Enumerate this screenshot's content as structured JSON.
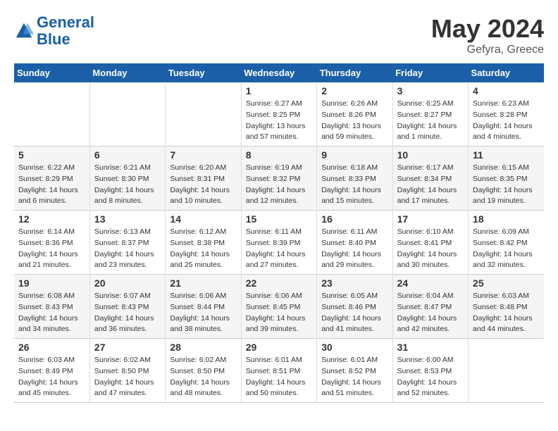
{
  "header": {
    "logo_line1": "General",
    "logo_line2": "Blue",
    "month_year": "May 2024",
    "location": "Gefyra, Greece"
  },
  "days_of_week": [
    "Sunday",
    "Monday",
    "Tuesday",
    "Wednesday",
    "Thursday",
    "Friday",
    "Saturday"
  ],
  "weeks": [
    [
      {
        "day": "",
        "info": ""
      },
      {
        "day": "",
        "info": ""
      },
      {
        "day": "",
        "info": ""
      },
      {
        "day": "1",
        "info": "Sunrise: 6:27 AM\nSunset: 8:25 PM\nDaylight: 13 hours\nand 57 minutes."
      },
      {
        "day": "2",
        "info": "Sunrise: 6:26 AM\nSunset: 8:26 PM\nDaylight: 13 hours\nand 59 minutes."
      },
      {
        "day": "3",
        "info": "Sunrise: 6:25 AM\nSunset: 8:27 PM\nDaylight: 14 hours\nand 1 minute."
      },
      {
        "day": "4",
        "info": "Sunrise: 6:23 AM\nSunset: 8:28 PM\nDaylight: 14 hours\nand 4 minutes."
      }
    ],
    [
      {
        "day": "5",
        "info": "Sunrise: 6:22 AM\nSunset: 8:29 PM\nDaylight: 14 hours\nand 6 minutes."
      },
      {
        "day": "6",
        "info": "Sunrise: 6:21 AM\nSunset: 8:30 PM\nDaylight: 14 hours\nand 8 minutes."
      },
      {
        "day": "7",
        "info": "Sunrise: 6:20 AM\nSunset: 8:31 PM\nDaylight: 14 hours\nand 10 minutes."
      },
      {
        "day": "8",
        "info": "Sunrise: 6:19 AM\nSunset: 8:32 PM\nDaylight: 14 hours\nand 12 minutes."
      },
      {
        "day": "9",
        "info": "Sunrise: 6:18 AM\nSunset: 8:33 PM\nDaylight: 14 hours\nand 15 minutes."
      },
      {
        "day": "10",
        "info": "Sunrise: 6:17 AM\nSunset: 8:34 PM\nDaylight: 14 hours\nand 17 minutes."
      },
      {
        "day": "11",
        "info": "Sunrise: 6:15 AM\nSunset: 8:35 PM\nDaylight: 14 hours\nand 19 minutes."
      }
    ],
    [
      {
        "day": "12",
        "info": "Sunrise: 6:14 AM\nSunset: 8:36 PM\nDaylight: 14 hours\nand 21 minutes."
      },
      {
        "day": "13",
        "info": "Sunrise: 6:13 AM\nSunset: 8:37 PM\nDaylight: 14 hours\nand 23 minutes."
      },
      {
        "day": "14",
        "info": "Sunrise: 6:12 AM\nSunset: 8:38 PM\nDaylight: 14 hours\nand 25 minutes."
      },
      {
        "day": "15",
        "info": "Sunrise: 6:11 AM\nSunset: 8:39 PM\nDaylight: 14 hours\nand 27 minutes."
      },
      {
        "day": "16",
        "info": "Sunrise: 6:11 AM\nSunset: 8:40 PM\nDaylight: 14 hours\nand 29 minutes."
      },
      {
        "day": "17",
        "info": "Sunrise: 6:10 AM\nSunset: 8:41 PM\nDaylight: 14 hours\nand 30 minutes."
      },
      {
        "day": "18",
        "info": "Sunrise: 6:09 AM\nSunset: 8:42 PM\nDaylight: 14 hours\nand 32 minutes."
      }
    ],
    [
      {
        "day": "19",
        "info": "Sunrise: 6:08 AM\nSunset: 8:43 PM\nDaylight: 14 hours\nand 34 minutes."
      },
      {
        "day": "20",
        "info": "Sunrise: 6:07 AM\nSunset: 8:43 PM\nDaylight: 14 hours\nand 36 minutes."
      },
      {
        "day": "21",
        "info": "Sunrise: 6:06 AM\nSunset: 8:44 PM\nDaylight: 14 hours\nand 38 minutes."
      },
      {
        "day": "22",
        "info": "Sunrise: 6:06 AM\nSunset: 8:45 PM\nDaylight: 14 hours\nand 39 minutes."
      },
      {
        "day": "23",
        "info": "Sunrise: 6:05 AM\nSunset: 8:46 PM\nDaylight: 14 hours\nand 41 minutes."
      },
      {
        "day": "24",
        "info": "Sunrise: 6:04 AM\nSunset: 8:47 PM\nDaylight: 14 hours\nand 42 minutes."
      },
      {
        "day": "25",
        "info": "Sunrise: 6:03 AM\nSunset: 8:48 PM\nDaylight: 14 hours\nand 44 minutes."
      }
    ],
    [
      {
        "day": "26",
        "info": "Sunrise: 6:03 AM\nSunset: 8:49 PM\nDaylight: 14 hours\nand 45 minutes."
      },
      {
        "day": "27",
        "info": "Sunrise: 6:02 AM\nSunset: 8:50 PM\nDaylight: 14 hours\nand 47 minutes."
      },
      {
        "day": "28",
        "info": "Sunrise: 6:02 AM\nSunset: 8:50 PM\nDaylight: 14 hours\nand 48 minutes."
      },
      {
        "day": "29",
        "info": "Sunrise: 6:01 AM\nSunset: 8:51 PM\nDaylight: 14 hours\nand 50 minutes."
      },
      {
        "day": "30",
        "info": "Sunrise: 6:01 AM\nSunset: 8:52 PM\nDaylight: 14 hours\nand 51 minutes."
      },
      {
        "day": "31",
        "info": "Sunrise: 6:00 AM\nSunset: 8:53 PM\nDaylight: 14 hours\nand 52 minutes."
      },
      {
        "day": "",
        "info": ""
      }
    ]
  ]
}
